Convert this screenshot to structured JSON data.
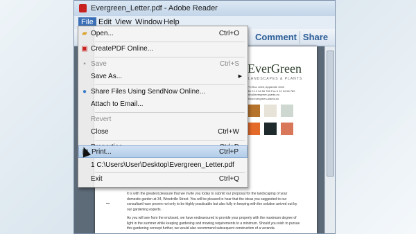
{
  "window": {
    "title": "Evergreen_Letter.pdf - Adobe Reader"
  },
  "menubar": {
    "items": [
      "File",
      "Edit",
      "View",
      "Window",
      "Help"
    ]
  },
  "toolbar": {
    "comment": "Comment",
    "share": "Share"
  },
  "document": {
    "logo_main": "EverGreen",
    "logo_sub": "LANDSCAPES & PLANTS",
    "address": [
      "PO Box 1245, Appleville 1004",
      "Tel 0 12 34 56 789  Fax 0 12 34 56 789",
      "info@evergreen-plants.eu",
      "www.evergreen-plants.eu"
    ],
    "paragraphs": [
      "It is with the greatest pleasure that we invite you today to submit our proposal for the landscaping of your domestic garden at 34, Woodville Street. You will be pleased to hear that the ideas you suggested to our consultant have proven not only to be highly practicable but also fully in keeping with the solution arrived out by our gardening experts.",
      "As you will see from the enclosed, we have endeavoured to provide your property with the maximum degree of light in the summer while keeping gardening and mowing requirements to a minimum. Should you wish to pursue this gardening concept further, we would also recommend subsequent construction of a veranda."
    ]
  },
  "file_menu": {
    "items": [
      {
        "label": "Open...",
        "shortcut": "Ctrl+O",
        "icon": "folder-icon",
        "disabled": false
      },
      {
        "label": "CreatePDF Online...",
        "shortcut": "",
        "icon": "pdf-create-icon",
        "disabled": false
      },
      {
        "label": "Save",
        "shortcut": "Ctrl+S",
        "icon": "save-icon",
        "disabled": true
      },
      {
        "label": "Save As...",
        "shortcut": "",
        "icon": "",
        "disabled": false,
        "submenu": true
      },
      {
        "label": "Share Files Using SendNow Online...",
        "shortcut": "",
        "icon": "share-icon",
        "disabled": false
      },
      {
        "label": "Attach to Email...",
        "shortcut": "",
        "icon": "",
        "disabled": false
      },
      {
        "label": "Revert",
        "shortcut": "",
        "icon": "",
        "disabled": true
      },
      {
        "label": "Close",
        "shortcut": "Ctrl+W",
        "icon": "",
        "disabled": false
      },
      {
        "label": "Properties...",
        "shortcut": "Ctrl+D",
        "icon": "",
        "disabled": false
      },
      {
        "label": "Print...",
        "shortcut": "Ctrl+P",
        "icon": "print-icon",
        "disabled": false,
        "highlighted": true
      },
      {
        "label": "1 C:\\Users\\User\\Desktop\\Evergreen_Letter.pdf",
        "shortcut": "",
        "icon": "",
        "disabled": false
      },
      {
        "label": "Exit",
        "shortcut": "Ctrl+Q",
        "icon": "",
        "disabled": false
      }
    ]
  },
  "colors": {
    "accent": "#3a6fb6",
    "highlight": "#b3cde9",
    "toolbar_text": "#2c5e97"
  }
}
